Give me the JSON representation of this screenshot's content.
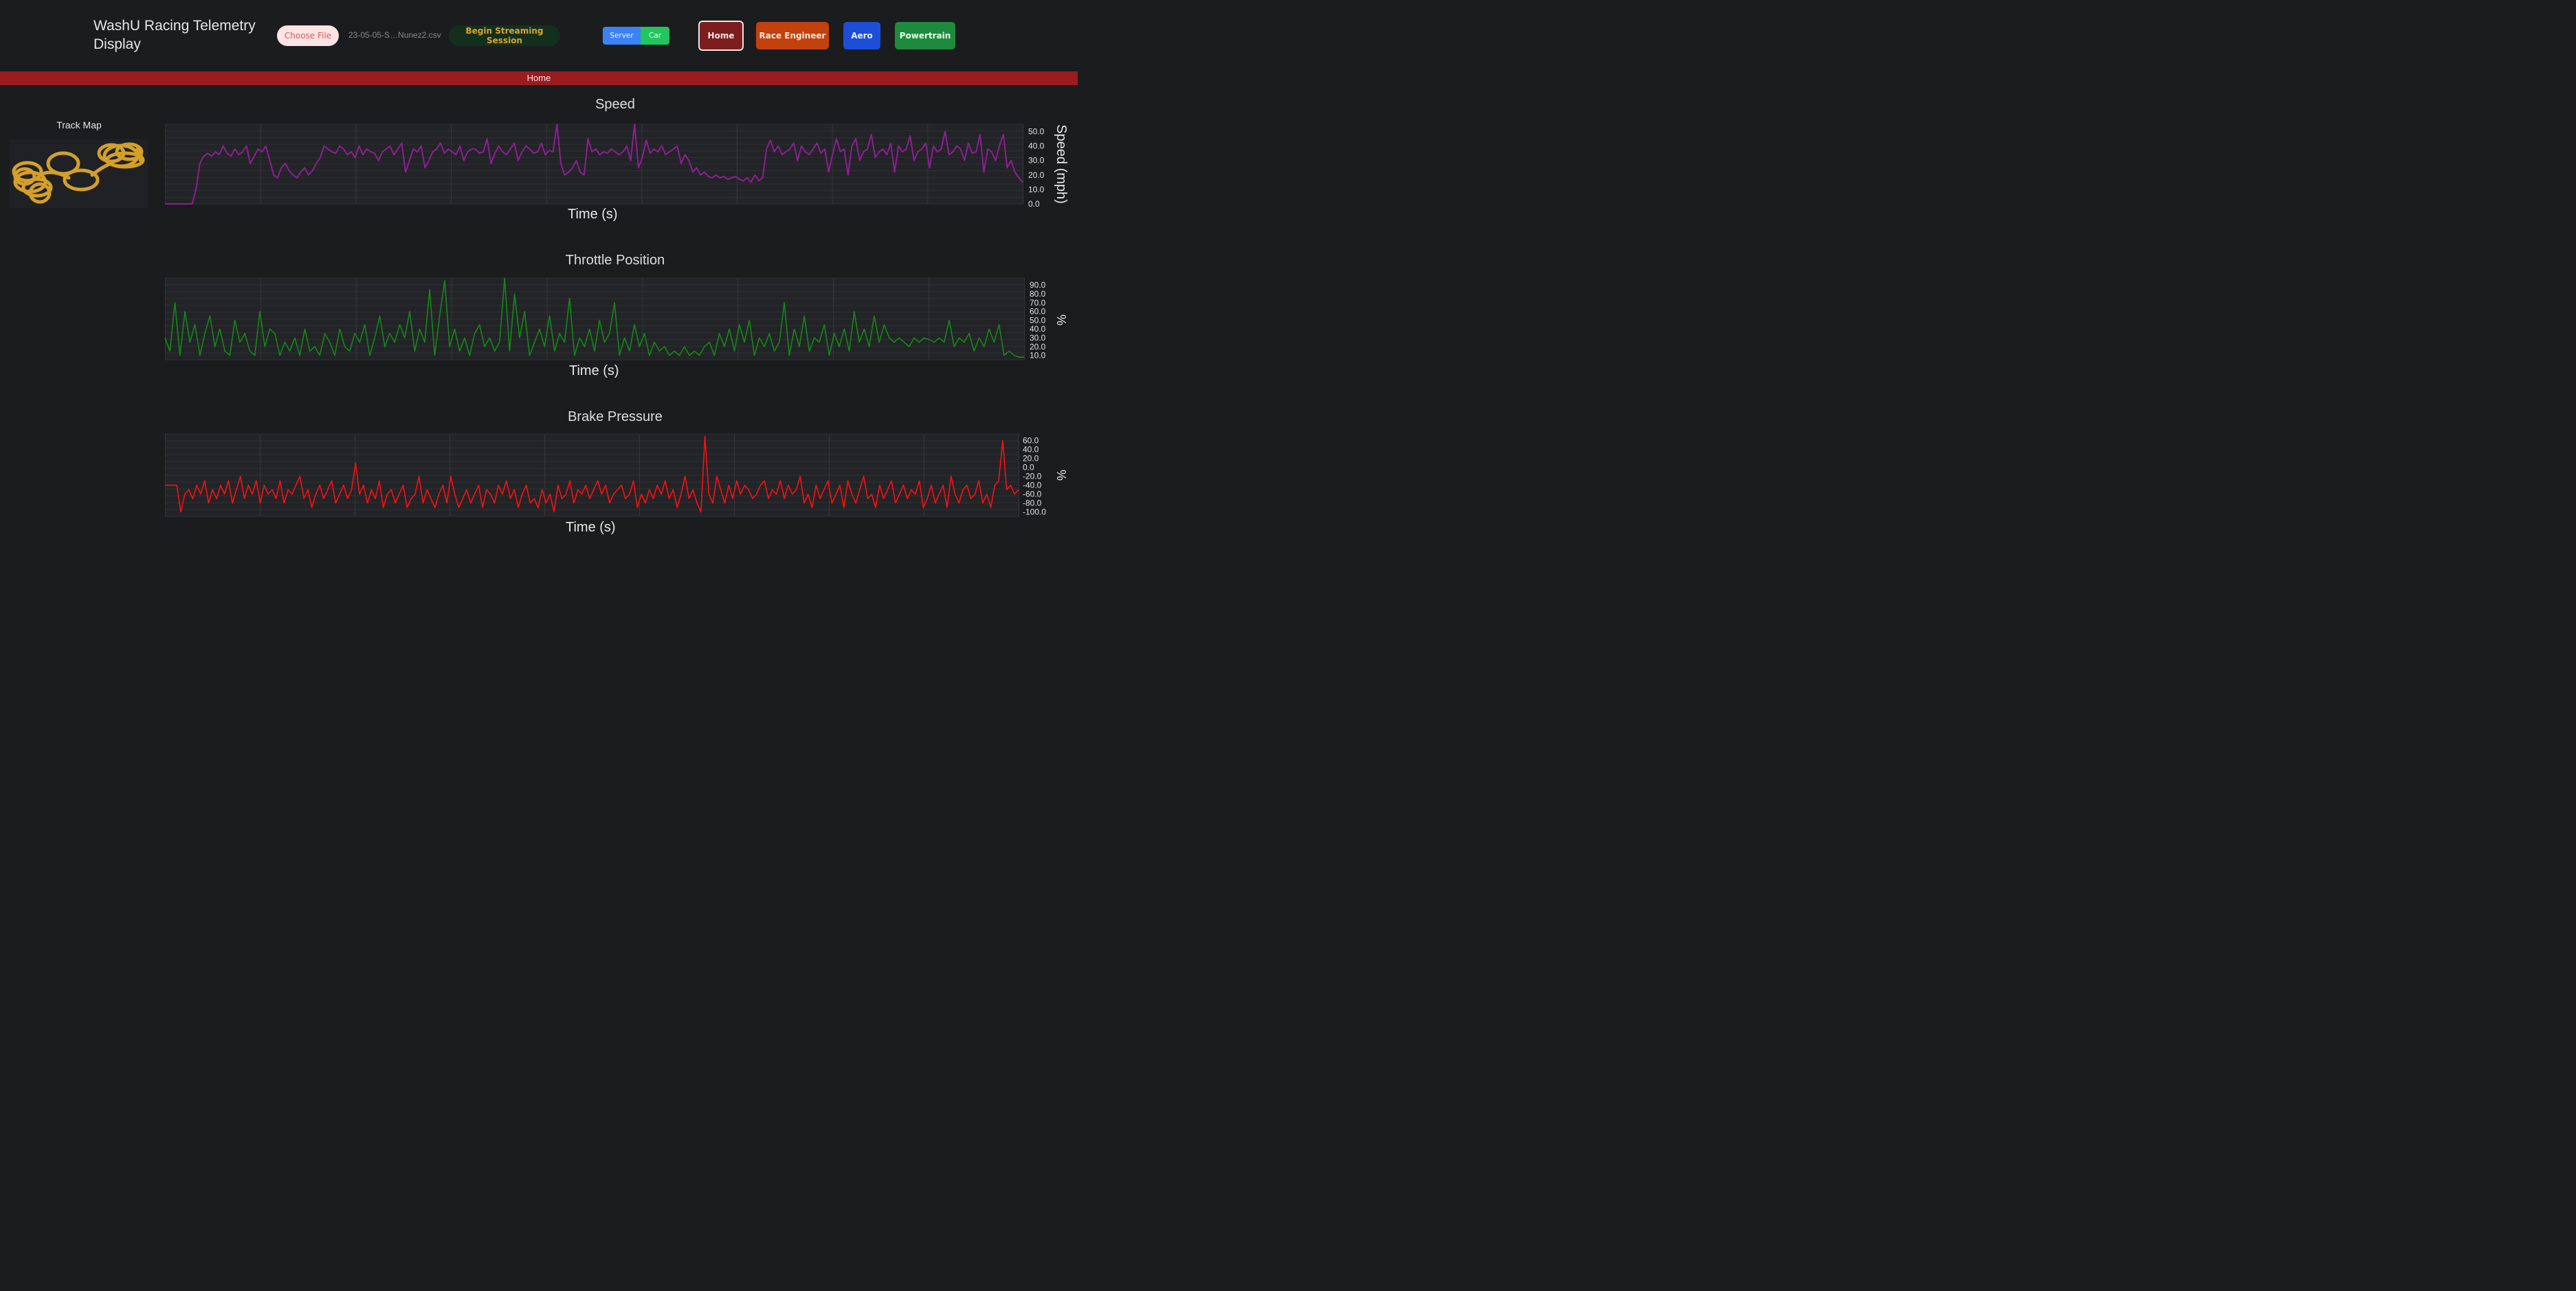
{
  "app": {
    "title": "WashU Racing Telemetry Display"
  },
  "toolbar": {
    "choose_file_label": "Choose File",
    "file_name": "23-05-05-S…Nunez2.csv",
    "stream_label": "Begin Streaming Session",
    "server_label": "Server",
    "car_label": "Car",
    "nav": {
      "home": "Home",
      "race_engineer": "Race Engineer",
      "aero": "Aero",
      "powertrain": "Powertrain"
    }
  },
  "banner": {
    "label": "Home"
  },
  "track_map": {
    "title": "Track Map",
    "trace_color": "#d4a02a"
  },
  "colors": {
    "background": "#1b1c1e",
    "banner": "#9b1b1f",
    "speed_line": "#8e1f96",
    "throttle_line": "#138a17",
    "brake_line": "#ff1010"
  },
  "chart_data": [
    {
      "type": "line",
      "title": "Speed",
      "xlabel": "Time (s)",
      "ylabel": "Speed (mph)",
      "ylim": [
        0,
        55
      ],
      "yticks": [
        "0.0",
        "10.0",
        "20.0",
        "30.0",
        "40.0",
        "50.0"
      ],
      "grid": true,
      "series": [
        {
          "values": [
            0,
            0,
            0,
            0,
            0,
            0,
            0,
            0,
            10,
            28,
            33,
            35,
            33,
            36,
            34,
            40,
            35,
            33,
            38,
            34,
            36,
            40,
            28,
            33,
            38,
            36,
            40,
            30,
            20,
            18,
            25,
            28,
            23,
            20,
            18,
            22,
            25,
            20,
            23,
            28,
            32,
            40,
            38,
            36,
            35,
            40,
            38,
            34,
            36,
            32,
            40,
            34,
            38,
            36,
            35,
            30,
            36,
            38,
            40,
            34,
            38,
            42,
            22,
            30,
            38,
            36,
            40,
            25,
            30,
            36,
            38,
            42,
            35,
            38,
            36,
            34,
            40,
            30,
            36,
            38,
            38,
            35,
            36,
            45,
            28,
            35,
            40,
            36,
            34,
            38,
            42,
            30,
            36,
            40,
            38,
            35,
            36,
            42,
            34,
            37,
            36,
            55,
            28,
            20,
            22,
            25,
            30,
            22,
            20,
            45,
            36,
            38,
            34,
            36,
            35,
            38,
            36,
            34,
            36,
            40,
            30,
            55,
            25,
            32,
            44,
            35,
            38,
            36,
            40,
            34,
            36,
            38,
            40,
            28,
            34,
            30,
            22,
            25,
            20,
            22,
            19,
            18,
            20,
            18,
            19,
            17,
            18,
            19,
            17,
            16,
            18,
            15,
            20,
            16,
            18,
            38,
            44,
            36,
            40,
            34,
            36,
            38,
            42,
            30,
            40,
            36,
            34,
            38,
            42,
            35,
            38,
            22,
            34,
            45,
            36,
            38,
            20,
            40,
            45,
            30,
            36,
            38,
            48,
            32,
            36,
            38,
            34,
            42,
            22,
            40,
            36,
            38,
            47,
            30,
            36,
            38,
            42,
            25,
            40,
            36,
            38,
            50,
            34,
            36,
            40,
            38,
            30,
            42,
            35,
            36,
            48,
            22,
            38,
            36,
            30,
            40,
            48,
            25,
            30,
            22,
            18,
            15
          ]
        }
      ]
    },
    {
      "type": "line",
      "title": "Throttle Position",
      "xlabel": "Time (s)",
      "ylabel": "%",
      "ylim": [
        5,
        98
      ],
      "yticks": [
        "10.0",
        "20.0",
        "30.0",
        "40.0",
        "50.0",
        "60.0",
        "70.0",
        "80.0",
        "90.0"
      ],
      "grid": true,
      "series": [
        {
          "values": [
            30,
            15,
            70,
            10,
            60,
            25,
            45,
            10,
            35,
            55,
            20,
            40,
            15,
            10,
            50,
            25,
            35,
            15,
            10,
            60,
            20,
            40,
            35,
            10,
            25,
            15,
            30,
            10,
            40,
            15,
            20,
            10,
            35,
            25,
            10,
            40,
            20,
            15,
            35,
            25,
            45,
            10,
            30,
            55,
            20,
            35,
            25,
            45,
            30,
            60,
            15,
            40,
            25,
            85,
            10,
            55,
            95,
            20,
            40,
            15,
            30,
            10,
            35,
            45,
            20,
            30,
            15,
            25,
            98,
            15,
            80,
            30,
            60,
            10,
            25,
            40,
            20,
            55,
            15,
            35,
            25,
            75,
            10,
            30,
            20,
            40,
            15,
            50,
            25,
            35,
            70,
            10,
            30,
            15,
            45,
            20,
            35,
            10,
            25,
            15,
            20,
            10,
            15,
            10,
            20,
            10,
            15,
            10,
            20,
            25,
            10,
            35,
            20,
            40,
            15,
            45,
            25,
            50,
            10,
            30,
            20,
            35,
            15,
            25,
            70,
            10,
            40,
            20,
            55,
            15,
            30,
            25,
            45,
            10,
            35,
            20,
            40,
            15,
            60,
            25,
            40,
            20,
            55,
            25,
            45,
            30,
            25,
            30,
            25,
            20,
            30,
            25,
            30,
            28,
            25,
            30,
            25,
            50,
            20,
            30,
            25,
            35,
            15,
            30,
            20,
            40,
            25,
            45,
            10,
            15,
            10,
            8,
            8
          ]
        }
      ]
    },
    {
      "type": "line",
      "title": "Brake Pressure",
      "xlabel": "Time (s)",
      "ylabel": "%",
      "ylim": [
        -110,
        75
      ],
      "yticks": [
        "-100.0",
        "-80.0",
        "-60.0",
        "-40.0",
        "-20.0",
        "0.0",
        "20.0",
        "40.0",
        "60.0"
      ],
      "grid": true,
      "series": [
        {
          "values": [
            -40,
            -40,
            -40,
            -40,
            -100,
            -60,
            -50,
            -70,
            -40,
            -60,
            -30,
            -80,
            -50,
            -70,
            -40,
            -60,
            -30,
            -80,
            -50,
            -20,
            -70,
            -40,
            -60,
            -30,
            -80,
            -40,
            -60,
            -50,
            -70,
            -30,
            -80,
            -50,
            -60,
            -40,
            -20,
            -70,
            -50,
            -90,
            -60,
            -40,
            -70,
            -50,
            -30,
            -80,
            -60,
            -40,
            -70,
            -50,
            10,
            -60,
            -40,
            -80,
            -50,
            -70,
            -30,
            -90,
            -60,
            -50,
            -80,
            -60,
            -40,
            -90,
            -70,
            -60,
            -20,
            -80,
            -50,
            -70,
            -90,
            -60,
            -40,
            -80,
            -20,
            -60,
            -90,
            -70,
            -50,
            -80,
            -60,
            -40,
            -90,
            -50,
            -60,
            -80,
            -40,
            -60,
            -30,
            -70,
            -50,
            -90,
            -60,
            -40,
            -80,
            -70,
            -90,
            -50,
            -80,
            -60,
            -100,
            -40,
            -70,
            -60,
            -30,
            -80,
            -50,
            -60,
            -40,
            -70,
            -50,
            -30,
            -60,
            -40,
            -80,
            -60,
            -50,
            -40,
            -70,
            -60,
            -30,
            -90,
            -60,
            -80,
            -50,
            -70,
            -40,
            -60,
            -30,
            -70,
            -50,
            -90,
            -60,
            -20,
            -70,
            -50,
            -80,
            -100,
            70,
            -60,
            -80,
            -20,
            -50,
            -80,
            -40,
            -70,
            -30,
            -60,
            -40,
            -50,
            -70,
            -60,
            -40,
            -30,
            -70,
            -50,
            -60,
            -30,
            -70,
            -40,
            -60,
            -50,
            -20,
            -80,
            -60,
            -90,
            -40,
            -70,
            -50,
            -30,
            -80,
            -60,
            -40,
            -90,
            -30,
            -60,
            -80,
            -50,
            -20,
            -70,
            -60,
            -90,
            -40,
            -70,
            -50,
            -30,
            -80,
            -60,
            -40,
            -70,
            -50,
            -60,
            -30,
            -90,
            -70,
            -40,
            -80,
            -60,
            -40,
            -90,
            -20,
            -60,
            -80,
            -50,
            -40,
            -70,
            -60,
            -30,
            -80,
            -60,
            -90,
            -40,
            -30,
            60,
            -50,
            -40,
            -60,
            -50
          ]
        }
      ]
    }
  ]
}
